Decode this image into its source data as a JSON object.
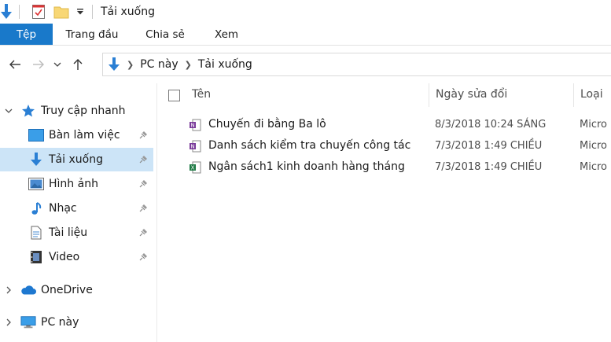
{
  "window": {
    "title": "Tải xuống"
  },
  "ribbon": {
    "tabs": [
      {
        "label": "Tệp"
      },
      {
        "label": "Trang đầu"
      },
      {
        "label": "Chia sẻ"
      },
      {
        "label": "Xem"
      }
    ]
  },
  "address": {
    "parts": [
      "PC này",
      "Tải xuống"
    ]
  },
  "nav": {
    "quick_access": "Truy cập nhanh",
    "items": [
      {
        "label": "Bàn làm việc"
      },
      {
        "label": "Tải xuống"
      },
      {
        "label": "Hình ảnh"
      },
      {
        "label": "Nhạc"
      },
      {
        "label": "Tài liệu"
      },
      {
        "label": "Video"
      }
    ],
    "onedrive": "OneDrive",
    "this_pc": "PC này"
  },
  "columns": {
    "name": "Tên",
    "date": "Ngày sửa đổi",
    "type": "Loại"
  },
  "files": [
    {
      "name": "Chuyến đi bằng Ba lô",
      "date": "8/3/2018 10:24 SÁNG",
      "type": "Micro",
      "icon": "onenote-icon"
    },
    {
      "name": "Danh sách kiểm tra chuyến công tác",
      "date": "7/3/2018 1:49 CHIỀU",
      "type": "Micro",
      "icon": "onenote-icon"
    },
    {
      "name": "Ngân sách1 kinh doanh hàng tháng",
      "date": "7/3/2018 1:49 CHIỀU",
      "type": "Micro",
      "icon": "excel-icon"
    }
  ],
  "colors": {
    "accent": "#1979ca",
    "selection": "#cce4f7",
    "download_arrow": "#2a7fd4"
  }
}
